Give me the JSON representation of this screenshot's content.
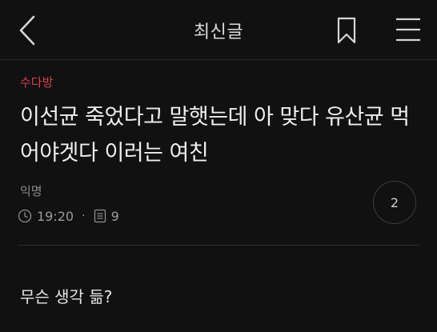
{
  "header": {
    "title": "최신글",
    "icons": [
      "back-icon",
      "bookmark-icon",
      "menu-icon"
    ]
  },
  "post": {
    "board": "수다방",
    "title": "이선균 죽었다고 말햇는데 아 맞다 유산균 먹어야겟다 이러는 여친",
    "author": "익명",
    "time": "19:20",
    "separator": "·",
    "views": "9",
    "comment_count": "2",
    "body": "무슨 생각 듦?"
  },
  "colors": {
    "background": "#111111",
    "board_accent": "#d8404e"
  }
}
